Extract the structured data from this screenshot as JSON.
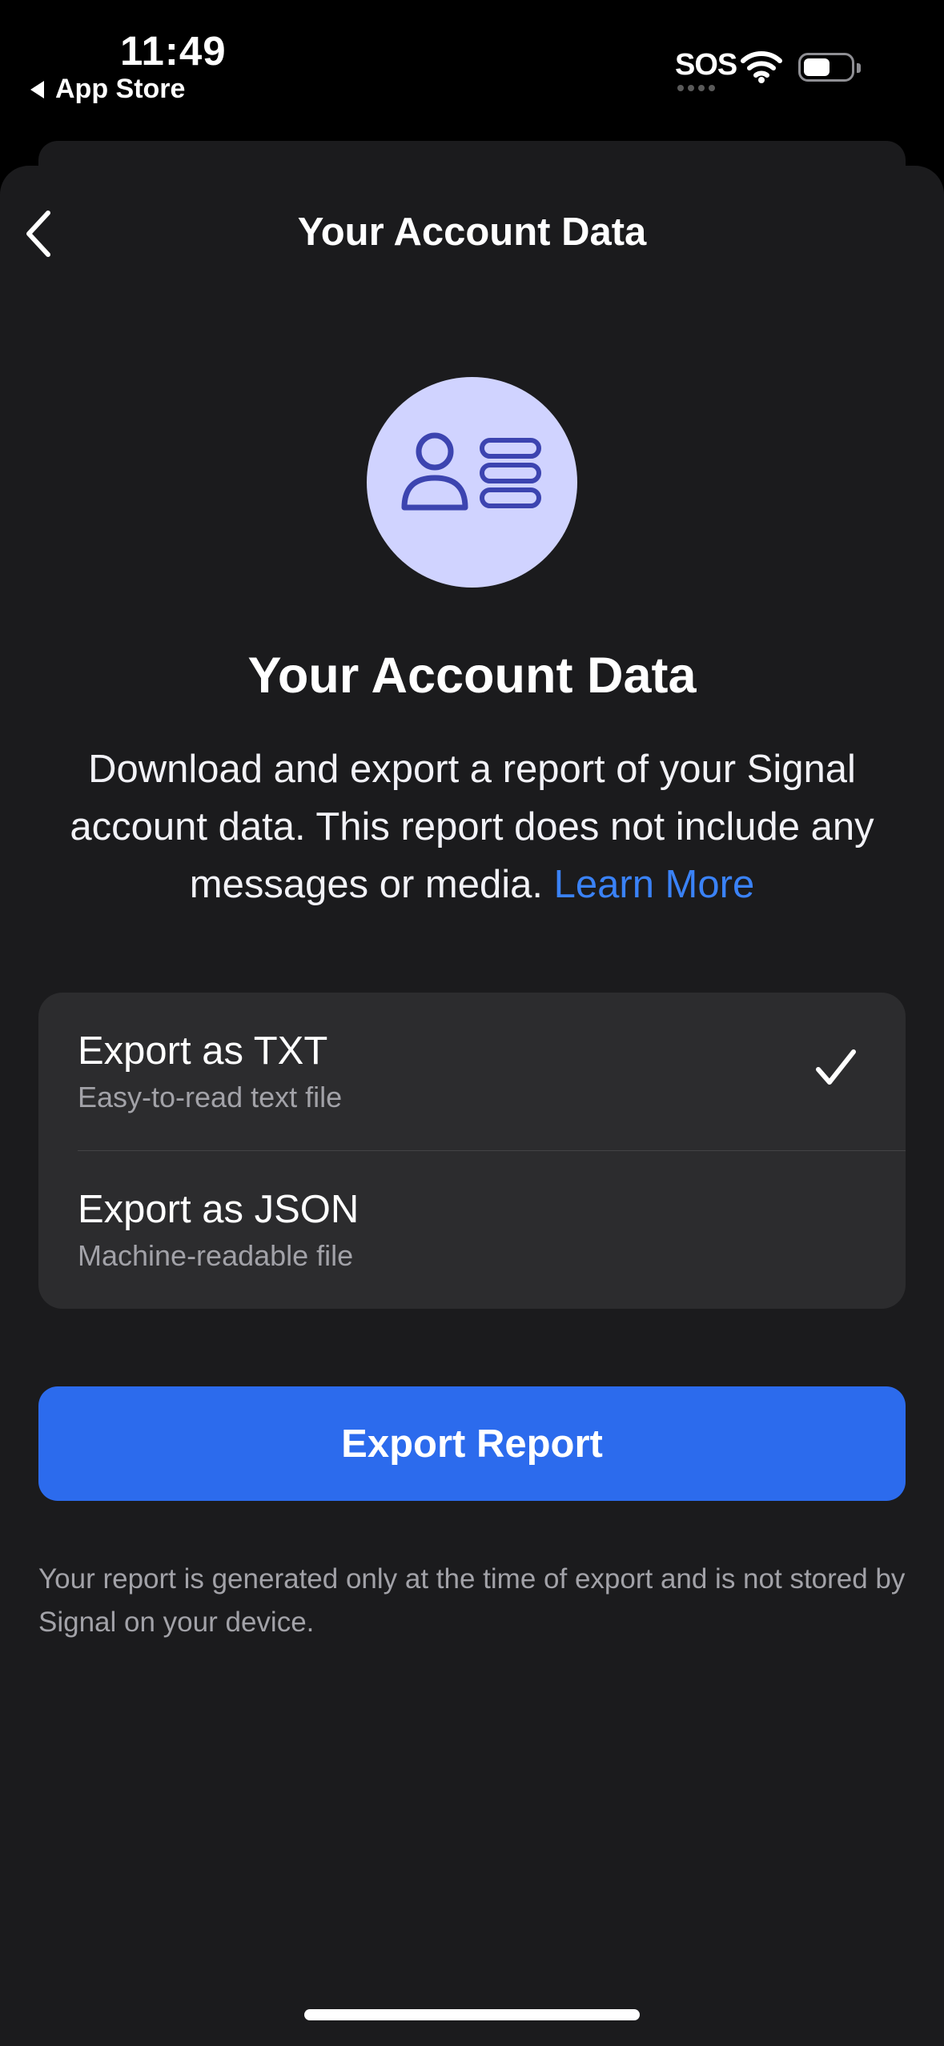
{
  "status_bar": {
    "time": "11:49",
    "back_app_label": "App Store",
    "carrier_text": "SOS"
  },
  "nav": {
    "title": "Your Account Data"
  },
  "header": {
    "heading": "Your Account Data",
    "description": "Download and export a report of your Signal account data. This report does not include any messages or media.",
    "learn_more": "Learn More"
  },
  "options": [
    {
      "title": "Export as TXT",
      "subtitle": "Easy-to-read text file",
      "selected": true
    },
    {
      "title": "Export as JSON",
      "subtitle": "Machine-readable file",
      "selected": false
    }
  ],
  "export_button": {
    "label": "Export Report"
  },
  "footnote": "Your report is generated only at the time of export and is not stored by Signal on your device.",
  "colors": {
    "accent": "#2c6bed",
    "link": "#3a82f7",
    "avatar_bg": "#d0d3ff",
    "avatar_icon": "#3c44b0",
    "sheet_bg": "#1b1b1d",
    "card_bg": "#2c2c2e"
  }
}
